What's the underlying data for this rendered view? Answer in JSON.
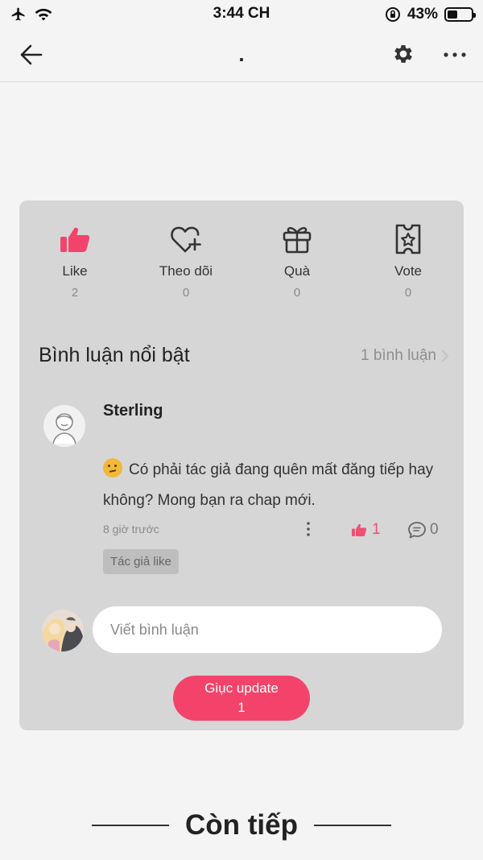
{
  "status_bar": {
    "time": "3:44 CH",
    "battery": "43%",
    "icons": [
      "airplane-icon",
      "wifi-icon",
      "orientation-lock-icon",
      "battery-icon"
    ]
  },
  "nav": {
    "title": ".",
    "icons": [
      "back-arrow-icon",
      "gear-icon",
      "more-icon"
    ]
  },
  "actions": [
    {
      "label": "Like",
      "count": "2",
      "icon": "thumbs-up-icon"
    },
    {
      "label": "Theo dõi",
      "count": "0",
      "icon": "heart-plus-icon"
    },
    {
      "label": "Quà",
      "count": "0",
      "icon": "gift-icon"
    },
    {
      "label": "Vote",
      "count": "0",
      "icon": "ticket-star-icon"
    }
  ],
  "featured": {
    "title": "Bình luận nổi bật",
    "count_label": "1 bình luận"
  },
  "comment": {
    "author": "Sterling",
    "text": "Có phải tác giả đang quên mất đăng tiếp hay không? Mong bạn ra chap mới.",
    "time": "8 giờ trước",
    "likes": "1",
    "replies": "0",
    "author_liked": "Tác giả like"
  },
  "compose": {
    "placeholder": "Viết bình luận"
  },
  "update_button": {
    "label": "Giục update",
    "count": "1"
  },
  "footer": {
    "more_label": "Còn tiếp"
  },
  "colors": {
    "accent": "#f4436a",
    "like": "#ef4f72",
    "card": "#d6d6d6",
    "background": "#f4f4f4"
  }
}
